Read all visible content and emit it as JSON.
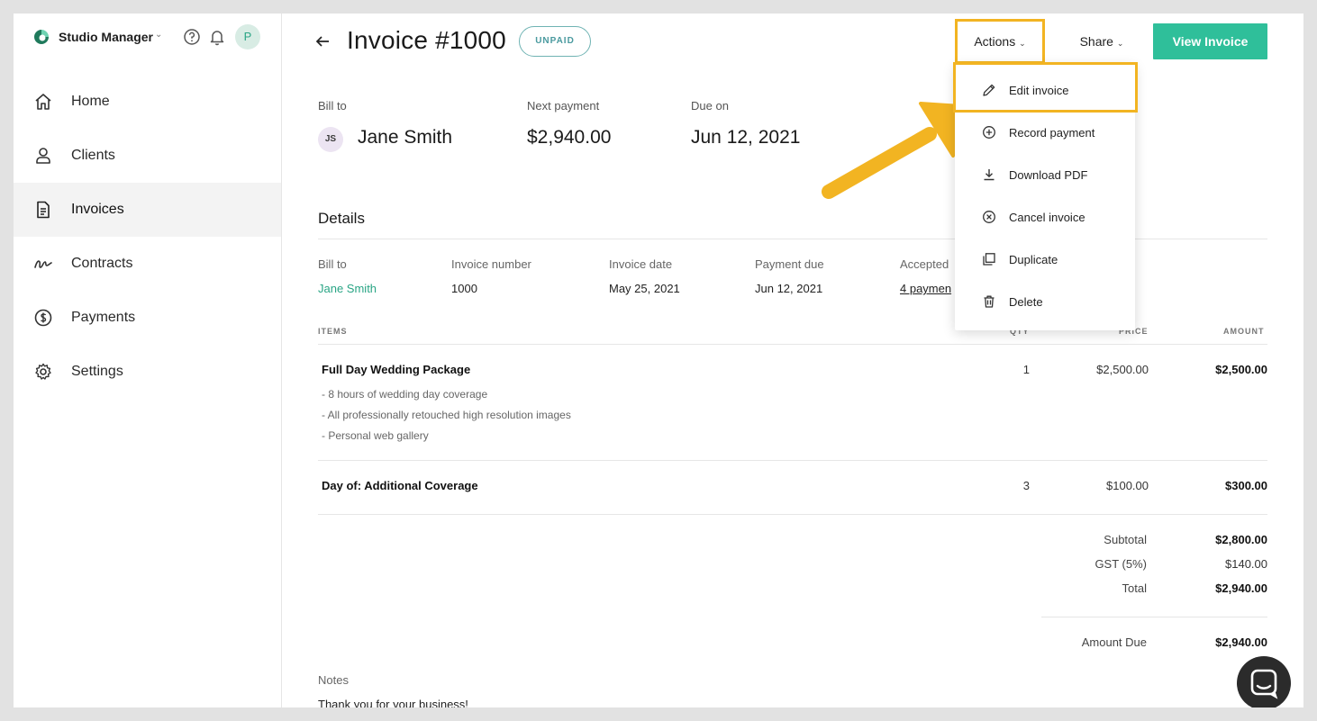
{
  "workspace": {
    "name": "Studio Manager",
    "avatar_initial": "P"
  },
  "nav": [
    {
      "label": "Home",
      "icon": "home-icon",
      "active": false
    },
    {
      "label": "Clients",
      "icon": "user-icon",
      "active": false
    },
    {
      "label": "Invoices",
      "icon": "document-icon",
      "active": true
    },
    {
      "label": "Contracts",
      "icon": "signature-icon",
      "active": false
    },
    {
      "label": "Payments",
      "icon": "dollar-circle-icon",
      "active": false
    },
    {
      "label": "Settings",
      "icon": "gear-icon",
      "active": false
    }
  ],
  "header": {
    "title": "Invoice #1000",
    "status": "UNPAID",
    "actions_label": "Actions",
    "share_label": "Share",
    "view_label": "View Invoice"
  },
  "summary": {
    "bill_to_label": "Bill to",
    "client_initials": "JS",
    "client_name": "Jane Smith",
    "next_payment_label": "Next payment",
    "next_payment": "$2,940.00",
    "due_on_label": "Due on",
    "due_on": "Jun 12, 2021"
  },
  "details": {
    "heading": "Details",
    "bill_to_label": "Bill to",
    "bill_to": "Jane Smith",
    "invoice_number_label": "Invoice number",
    "invoice_number": "1000",
    "invoice_date_label": "Invoice date",
    "invoice_date": "May 25, 2021",
    "payment_due_label": "Payment due",
    "payment_due": "Jun 12, 2021",
    "accepted_label": "Accepted",
    "accepted": "4 paymen"
  },
  "table": {
    "headers": {
      "items": "ITEMS",
      "qty": "QTY",
      "price": "PRICE",
      "amount": "AMOUNT"
    },
    "rows": [
      {
        "name": "Full Day Wedding Package",
        "desc": [
          "- 8 hours of wedding day coverage",
          "- All professionally retouched high resolution images",
          "- Personal web gallery"
        ],
        "qty": "1",
        "price": "$2,500.00",
        "amount": "$2,500.00"
      },
      {
        "name": "Day of: Additional Coverage",
        "qty": "3",
        "price": "$100.00",
        "amount": "$300.00"
      }
    ]
  },
  "totals": {
    "subtotal_label": "Subtotal",
    "subtotal": "$2,800.00",
    "gst_label": "GST (5%)",
    "gst": "$140.00",
    "total_label": "Total",
    "total": "$2,940.00",
    "amount_due_label": "Amount Due",
    "amount_due": "$2,940.00"
  },
  "notes": {
    "label": "Notes",
    "text": "Thank you for your business!"
  },
  "actions_menu": [
    {
      "label": "Edit invoice",
      "icon": "pencil-icon"
    },
    {
      "label": "Record payment",
      "icon": "plus-circle-icon"
    },
    {
      "label": "Download PDF",
      "icon": "download-icon"
    },
    {
      "label": "Cancel invoice",
      "icon": "x-circle-icon"
    },
    {
      "label": "Duplicate",
      "icon": "duplicate-icon"
    },
    {
      "label": "Delete",
      "icon": "trash-icon"
    }
  ],
  "colors": {
    "accent": "#2fbf9a",
    "highlight": "#f2b422",
    "link": "#2aa585"
  }
}
